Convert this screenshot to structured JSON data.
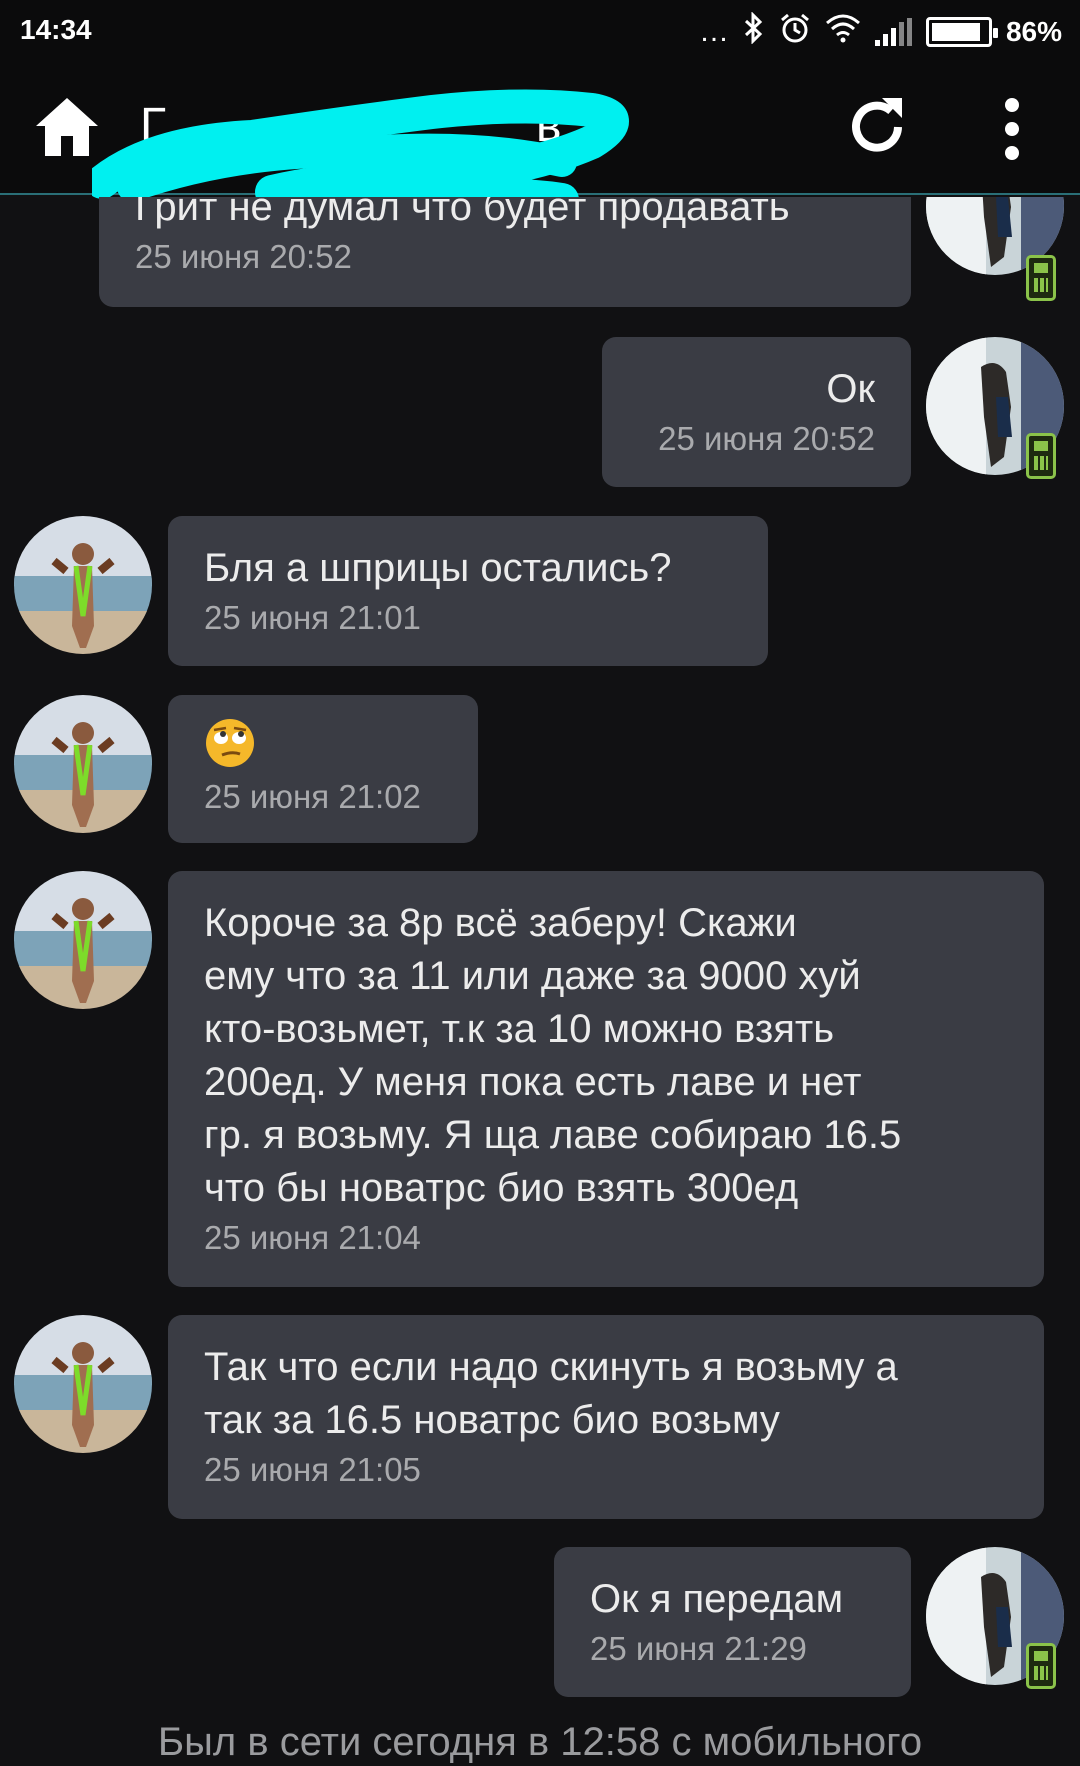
{
  "status_bar": {
    "time": "14:34",
    "battery": "86%",
    "icons": [
      "more-dots-icon",
      "bluetooth-icon",
      "alarm-icon",
      "wifi-icon",
      "signal-icon",
      "battery-icon"
    ]
  },
  "app_bar": {
    "title": "Г",
    "title_end": "в",
    "icons": [
      "home-icon",
      "refresh-icon",
      "more-vert-icon"
    ],
    "redaction_color": "#00f0f0"
  },
  "messages": [
    {
      "direction": "out",
      "text": "Грит не думал что будет продавать",
      "time": "25 июня 20:52"
    },
    {
      "direction": "out",
      "text": "Ок",
      "time": "25 июня 20:52"
    },
    {
      "direction": "in",
      "text": "Бля а шприцы остались?",
      "time": "25 июня 21:01"
    },
    {
      "direction": "in",
      "emoji": "face-with-rolling-eyes-icon",
      "time": "25 июня 21:02"
    },
    {
      "direction": "in",
      "text": "Короче за 8р всё заберу! Скажи\nему что за 11 или даже за 9000 хуй\nкто-возьмет, т.к за 10 можно взять\n200ед. У меня пока есть лаве и нет\nгр. я возьму. Я ща лаве собираю 16.5\nчто бы новатрс био взять 300ед",
      "time": "25 июня 21:04"
    },
    {
      "direction": "in",
      "text": "Так что если надо скинуть я возьму а\nтак за 16.5 новатрс био возьму",
      "time": "25 июня 21:05"
    },
    {
      "direction": "out",
      "text": "Ок я передам",
      "time": "25 июня 21:29"
    }
  ],
  "footer": {
    "last_seen": "Был в сети сегодня в 12:58 с мобильного"
  },
  "colors": {
    "background": "#111113",
    "bubble": "#3a3c44",
    "accent_line": "#2a6f77",
    "mobile_badge": "#8bc34a"
  }
}
